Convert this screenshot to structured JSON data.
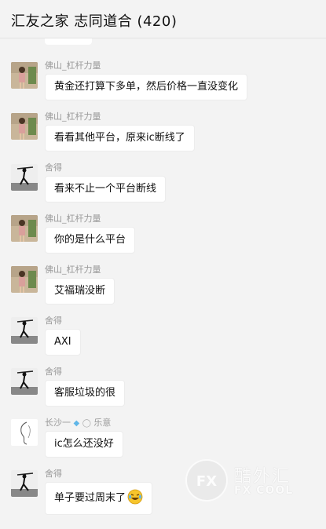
{
  "header": {
    "title": "汇友之家 志同道合 (420)"
  },
  "messages": [
    {
      "sender": "佛山_杠杆力量",
      "text": "黄金还打算下多单，然后价格一直没变化",
      "avatar": "woman-photo-avatar"
    },
    {
      "sender": "佛山_杠杆力量",
      "text": "看看其他平台，原来ic断线了",
      "avatar": "woman-photo-avatar"
    },
    {
      "sender": "舍得",
      "text": "看来不止一个平台断线",
      "avatar": "ink-figure-avatar"
    },
    {
      "sender": "佛山_杠杆力量",
      "text": "你的是什么平台",
      "avatar": "woman-photo-avatar"
    },
    {
      "sender": "佛山_杠杆力量",
      "text": "艾福瑞没断",
      "avatar": "woman-photo-avatar"
    },
    {
      "sender": "舍得",
      "text": "AXI",
      "avatar": "ink-figure-avatar"
    },
    {
      "sender": "舍得",
      "text": "客服垃圾的很",
      "avatar": "ink-figure-avatar"
    },
    {
      "sender": "长沙一",
      "sender_suffix": "乐意",
      "text": "ic怎么还没好",
      "avatar": "sketch-avatar"
    },
    {
      "sender": "舍得",
      "text": "单子要过周末了",
      "avatar": "ink-figure-avatar",
      "emoji": "laughing-crying-emoji"
    }
  ],
  "watermark": {
    "logo": "FX",
    "cn": "酷外汇",
    "en": "FX COOL"
  },
  "colors": {
    "background": "#f3f3f3",
    "bubble": "#ffffff",
    "sender": "#9a9a9a",
    "text": "#111111"
  }
}
